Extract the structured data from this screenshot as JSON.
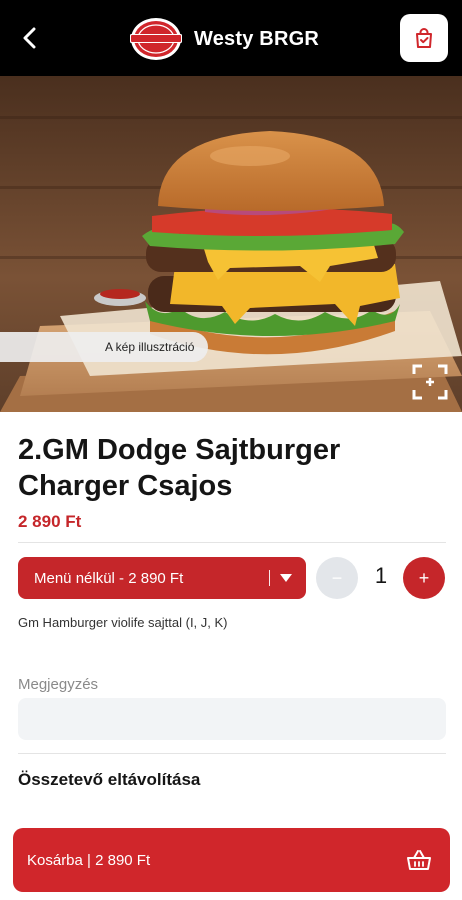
{
  "header": {
    "title": "Westy BRGR",
    "logo_text": "Westy BRGR"
  },
  "hero": {
    "illustration_note": "A kép illusztráció"
  },
  "product": {
    "name": "2.GM Dodge Sajtburger Charger Csajos",
    "price": "2 890 Ft",
    "menu_option": "Menü nélkül - 2 890 Ft",
    "quantity": "1",
    "description": "Gm Hamburger violife sajttal (I, J, K)"
  },
  "note": {
    "label": "Megjegyzés",
    "value": "",
    "placeholder": ""
  },
  "remove_ingredients": "Összetevő eltávolítása",
  "cart_button": "Kosárba | 2 890 Ft",
  "colors": {
    "accent": "#c5262a",
    "topbar": "#000000",
    "qty_minus": "#e3e6ea"
  },
  "icons": [
    "back-arrow-icon",
    "shopping-bag-icon",
    "scan-zoom-icon",
    "minus-icon",
    "plus-icon",
    "basket-icon",
    "chevron-down-icon"
  ]
}
